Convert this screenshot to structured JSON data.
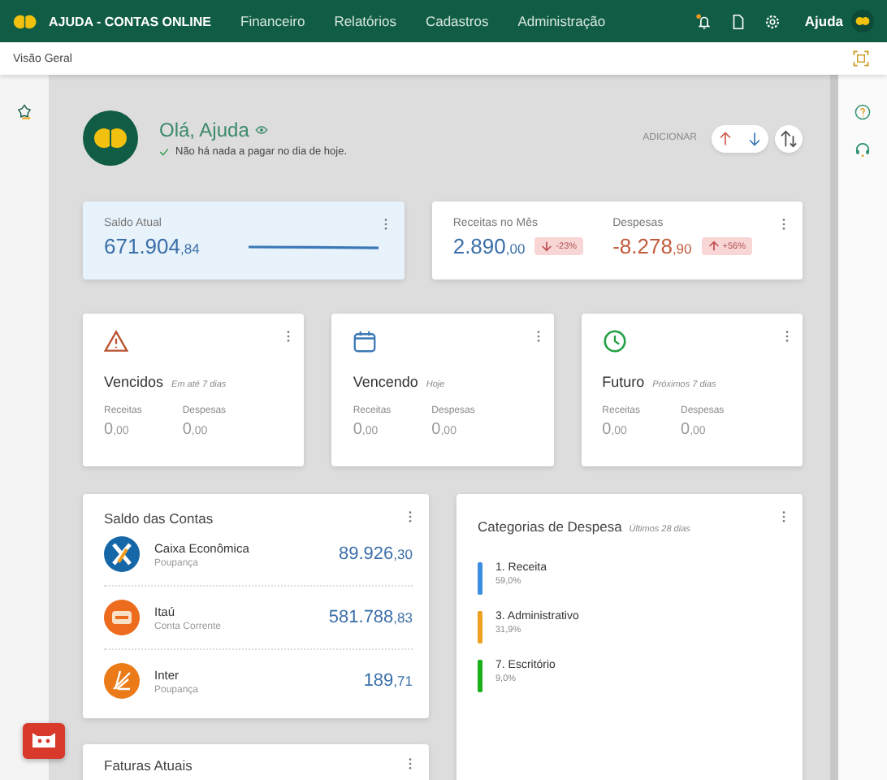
{
  "nav": {
    "brand": "AJUDA - CONTAS ONLINE",
    "menu": [
      "Financeiro",
      "Relatórios",
      "Cadastros",
      "Administração"
    ],
    "user": "Ajuda"
  },
  "breadcrumb": "Visão Geral",
  "greeting": {
    "title": "Olá, Ajuda",
    "message": "Não há nada a pagar no dia de hoje.",
    "add_label": "ADICIONAR"
  },
  "balance": {
    "label": "Saldo Atual",
    "value": "671.904",
    "cents": ",84"
  },
  "month": [
    {
      "kind": "income",
      "label": "Receitas no Mês",
      "value": "2.890",
      "cents": ",00",
      "change": {
        "text": "-23%",
        "kind": "down"
      }
    },
    {
      "kind": "expense",
      "label": "Despesas",
      "value": "-8.278",
      "cents": ",90",
      "change": {
        "text": "+56%",
        "kind": "up"
      }
    }
  ],
  "periods": [
    {
      "kind": "overdue",
      "title": "Vencidos",
      "subtitle": "Em até 7 dias",
      "income_label": "Receitas",
      "income": "0",
      "income_cents": ",00",
      "expense_label": "Despesas",
      "expense": "0",
      "expense_cents": ",00"
    },
    {
      "kind": "today",
      "title": "Vencendo",
      "subtitle": "Hoje",
      "income_label": "Receitas",
      "income": "0",
      "income_cents": ",00",
      "expense_label": "Despesas",
      "expense": "0",
      "expense_cents": ",00"
    },
    {
      "kind": "future",
      "title": "Futuro",
      "subtitle": "Próximos 7 dias",
      "income_label": "Receitas",
      "income": "0",
      "income_cents": ",00",
      "expense_label": "Despesas",
      "expense": "0",
      "expense_cents": ",00"
    }
  ],
  "accounts": {
    "title": "Saldo das Contas",
    "items": [
      {
        "kind": "caixa",
        "name": "Caixa Econômica",
        "type": "Poupança",
        "value": "89.926",
        "cents": ",30"
      },
      {
        "kind": "itau",
        "name": "Itaú",
        "type": "Conta Corrente",
        "value": "581.788",
        "cents": ",83"
      },
      {
        "kind": "inter",
        "name": "Inter",
        "type": "Poupança",
        "value": "189",
        "cents": ",71"
      }
    ]
  },
  "categories": {
    "title": "Categorias de Despesa",
    "subtitle": "Últimos 28 dias",
    "items": [
      {
        "name": "1. Receita",
        "percent": "59,0%",
        "color": "#3d8ee0"
      },
      {
        "name": "3. Administrativo",
        "percent": "31,9%",
        "color": "#f0a020"
      },
      {
        "name": "7. Escritório",
        "percent": "9,0%",
        "color": "#19b019"
      }
    ]
  },
  "invoices": {
    "title": "Faturas Atuais"
  }
}
